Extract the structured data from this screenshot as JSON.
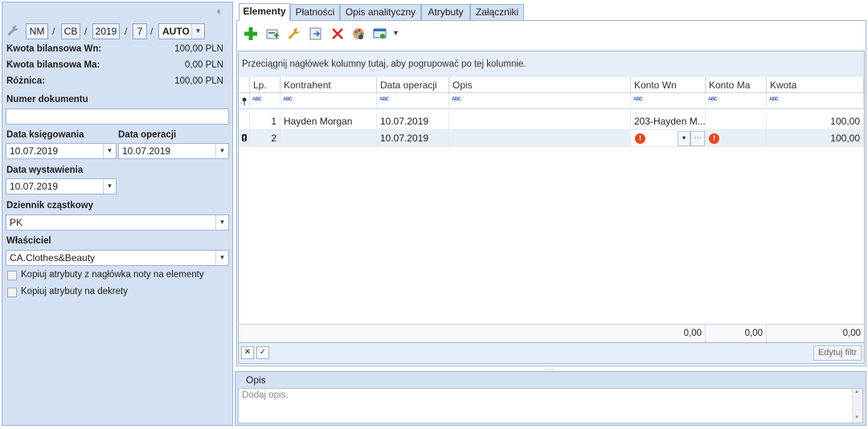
{
  "left": {
    "numbering": {
      "p1": "NM",
      "p2": "CB",
      "p3": "2019",
      "p4": "7",
      "p5": "AUTO",
      "sep": "/"
    },
    "balances": [
      {
        "label": "Kwota bilansowa Wn:",
        "value": "100,00 PLN"
      },
      {
        "label": "Kwota bilansowa Ma:",
        "value": "0,00 PLN"
      },
      {
        "label": "Różnica:",
        "value": "100,00 PLN"
      }
    ],
    "doc_number_label": "Numer dokumentu",
    "doc_number_value": "",
    "booking_date_label": "Data księgowania",
    "booking_date_value": "10.07.2019",
    "operation_date_label": "Data operacji",
    "operation_date_value": "10.07.2019",
    "issue_date_label": "Data wystawienia",
    "issue_date_value": "10.07.2019",
    "journal_label": "Dziennik cząstkowy",
    "journal_value": "PK",
    "owner_label": "Właściciel",
    "owner_value": "CA.Clothes&Beauty",
    "copy_attr_header_label": "Kopiuj atrybuty z nagłówka noty na elementy",
    "copy_attr_entries_label": "Kopiuj atrybuty na dekrety"
  },
  "tabs": [
    "Elementy",
    "Płatności",
    "Opis analityczny",
    "Atrybuty",
    "Załączniki"
  ],
  "grid": {
    "group_hint": "Przeciągnij nagłówek kolumny tutaj, aby pogrupować po tej kolumnie.",
    "columns": [
      "Lp.",
      "Kontrahent",
      "Data operacji",
      "Opis",
      "Konto Wn",
      "Konto Ma",
      "Kwota"
    ],
    "filter_marker": "ABC",
    "rows": [
      {
        "lp": "1",
        "kontrahent": "Hayden Morgan",
        "data": "10.07.2019",
        "opis": "",
        "wn": "203-Hayden M...",
        "ma": "",
        "kwota": "100,00"
      },
      {
        "lp": "2",
        "kontrahent": "",
        "data": "10.07.2019",
        "opis": "",
        "wn": "",
        "ma": "",
        "kwota": "100,00"
      }
    ],
    "footer_sums": [
      "0,00",
      "0,00",
      "0,00"
    ],
    "edit_filter_label": "Edytuj filtr",
    "more_btn": "···"
  },
  "opis": {
    "title": "Opis",
    "placeholder": "Dodaj opis."
  },
  "colors": {
    "panel": "#d4e1f2",
    "border": "#9eb3d3",
    "add": "#2ca02c",
    "delete": "#d9261c",
    "error": "#e24a1c"
  }
}
